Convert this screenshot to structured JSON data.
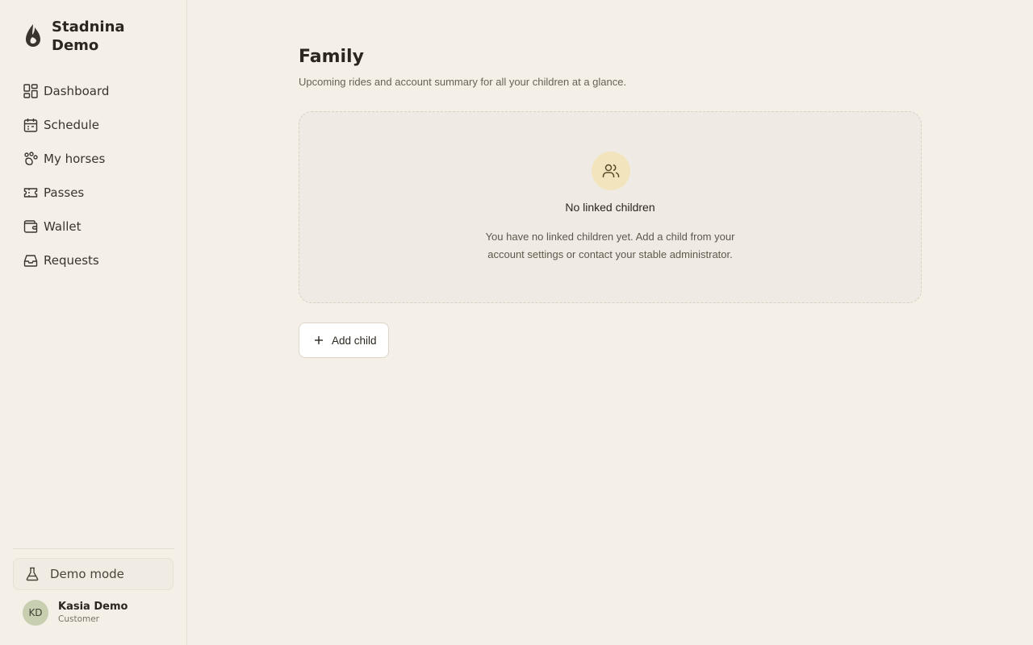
{
  "app": {
    "brand_name": "Stadnina Demo",
    "logo_icon": "drop-icon"
  },
  "sidebar": {
    "items": [
      {
        "label": "Dashboard",
        "icon": "dashboard-grid-icon"
      },
      {
        "label": "Schedule",
        "icon": "calendar-icon"
      },
      {
        "label": "My horses",
        "icon": "hoofprint-icon"
      },
      {
        "label": "Passes",
        "icon": "ticket-icon"
      },
      {
        "label": "Wallet",
        "icon": "wallet-icon"
      },
      {
        "label": "Requests",
        "icon": "inbox-icon"
      }
    ],
    "demo_mode": {
      "label": "Demo mode",
      "icon": "flask-icon"
    },
    "user": {
      "initials": "KD",
      "name": "Kasia Demo",
      "role": "Customer"
    }
  },
  "main": {
    "title": "Family",
    "subtitle": "Upcoming rides and account summary for all your children at a glance.",
    "empty_state": {
      "icon": "users-icon",
      "title": "No linked children",
      "description": "You have no linked children yet. Add a child from your account settings or contact your stable administrator."
    },
    "add_child_button": {
      "label": "Add child",
      "icon": "plus-icon"
    }
  },
  "colors": {
    "background": "#f4f0e8",
    "card_background": "#efebe4",
    "empty_icon_background": "#f2e4bd",
    "avatar_background": "#c8ceb0",
    "text_primary": "#2b2620"
  }
}
